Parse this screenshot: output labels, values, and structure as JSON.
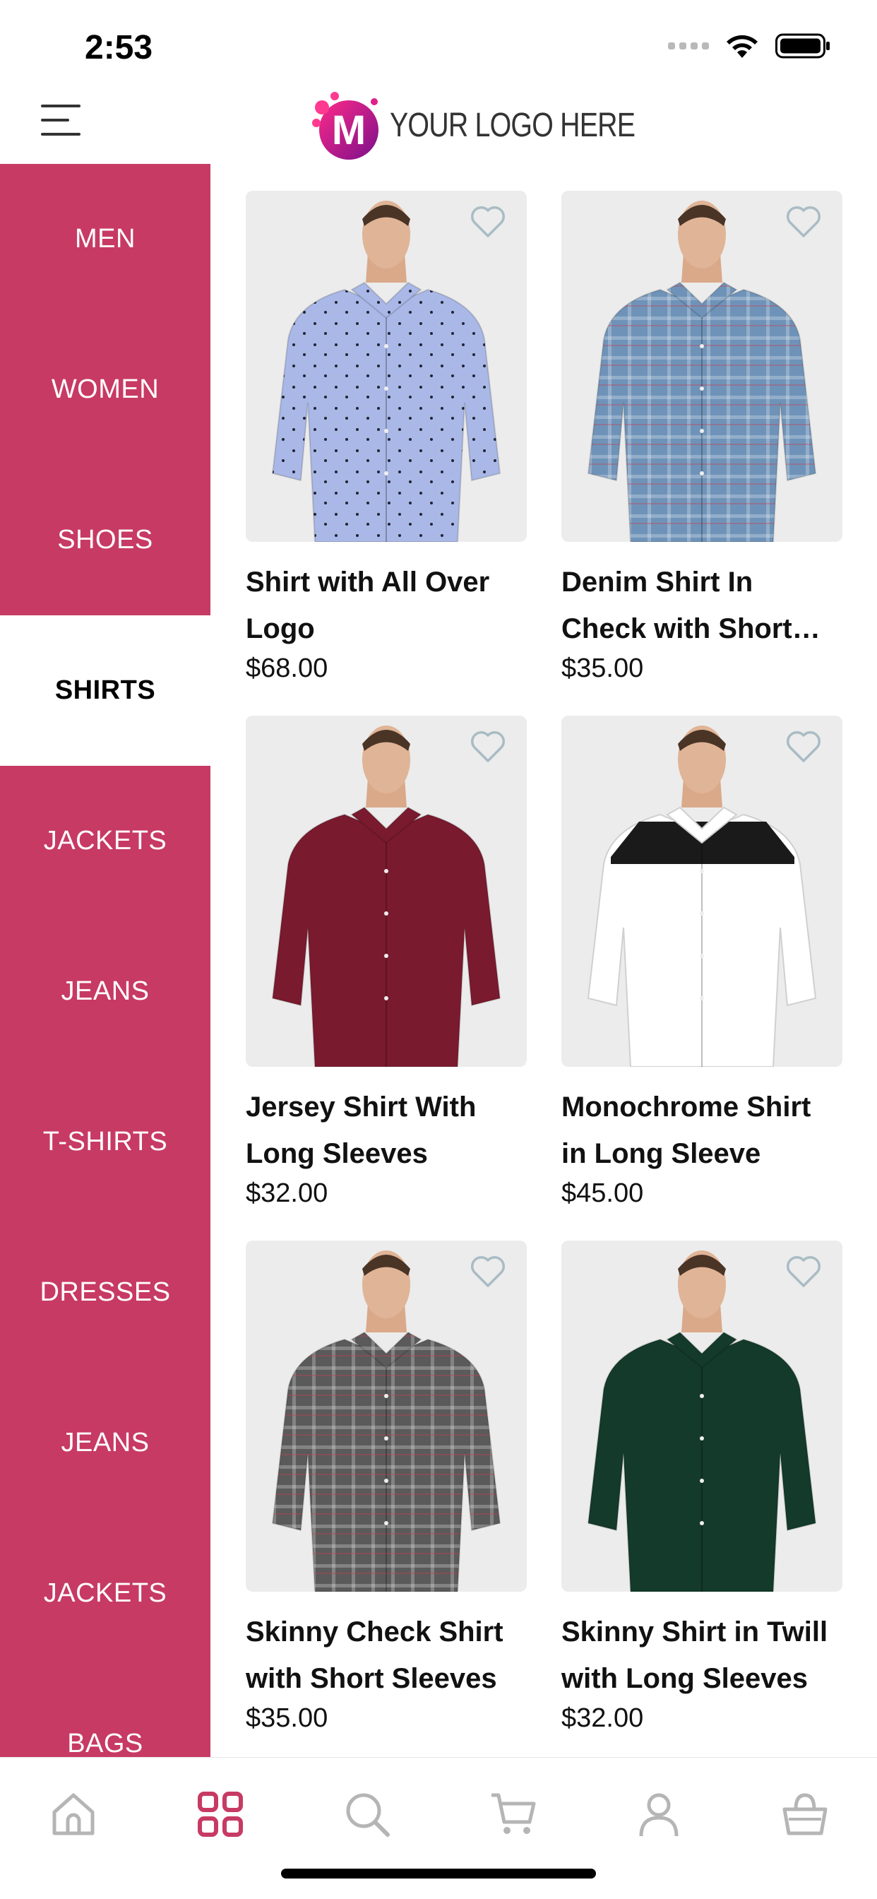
{
  "status_bar": {
    "time": "2:53"
  },
  "header": {
    "logo_text": "YOUR LOGO HERE",
    "logo_letter": "M"
  },
  "colors": {
    "accent": "#c73a64",
    "logo_gradient_start": "#ff2a8a",
    "logo_gradient_end": "#7a0f8a",
    "inactive_icon": "#b5b5b5"
  },
  "sidebar": {
    "active_index": 3,
    "items": [
      {
        "label": "MEN"
      },
      {
        "label": "WOMEN"
      },
      {
        "label": "SHOES"
      },
      {
        "label": "SHIRTS"
      },
      {
        "label": "JACKETS"
      },
      {
        "label": "JEANS"
      },
      {
        "label": "T-SHIRTS"
      },
      {
        "label": "DRESSES"
      },
      {
        "label": "JEANS"
      },
      {
        "label": "JACKETS"
      },
      {
        "label": "BAGS"
      }
    ]
  },
  "products": [
    {
      "title": "Shirt with All Over Logo",
      "price": "$68.00",
      "shirt_color": "#a9b8e6",
      "pattern": "dots"
    },
    {
      "title": "Denim Shirt In Check with Short Sleeves",
      "price": "$35.00",
      "shirt_color": "#6f93b8",
      "pattern": "check"
    },
    {
      "title": "Jersey Shirt With Long Sleeves",
      "price": "$32.00",
      "shirt_color": "#7a1a2e",
      "pattern": "plain"
    },
    {
      "title": "Monochrome Shirt in Long Sleeve",
      "price": "$45.00",
      "shirt_color": "#ffffff",
      "pattern": "mono"
    },
    {
      "title": "Skinny Check Shirt with Short Sleeves",
      "price": "$35.00",
      "shirt_color": "#5a5a5a",
      "pattern": "check"
    },
    {
      "title": "Skinny Shirt in Twill with Long Sleeves",
      "price": "$32.00",
      "shirt_color": "#133a2a",
      "pattern": "plain"
    }
  ],
  "tabbar": {
    "active_index": 1,
    "tabs": [
      {
        "icon": "home-icon"
      },
      {
        "icon": "grid-icon"
      },
      {
        "icon": "search-icon"
      },
      {
        "icon": "cart-icon"
      },
      {
        "icon": "profile-icon"
      },
      {
        "icon": "basket-icon"
      }
    ]
  }
}
